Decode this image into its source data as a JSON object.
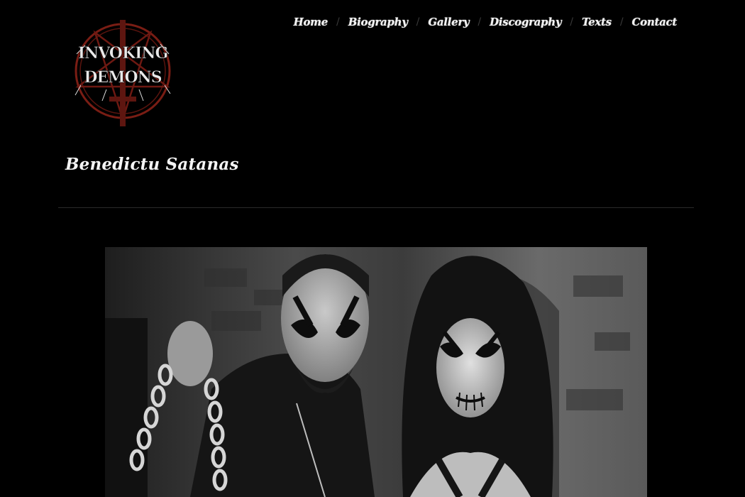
{
  "site": {
    "logo_text_line1": "INVOKING",
    "logo_text_line2": "DEMONS"
  },
  "nav": {
    "items": [
      {
        "label": "Home"
      },
      {
        "label": "Biography"
      },
      {
        "label": "Gallery"
      },
      {
        "label": "Discography"
      },
      {
        "label": "Texts"
      },
      {
        "label": "Contact"
      }
    ],
    "separator": "/"
  },
  "page": {
    "title": "Benedictu Satanas"
  },
  "colors": {
    "background": "#000000",
    "nav_text": "#f2f2f2",
    "separator": "#3a3a3a",
    "logo_red": "#7a1d14",
    "divider": "#2a2a2a"
  },
  "photo": {
    "icon": "band-photo"
  }
}
